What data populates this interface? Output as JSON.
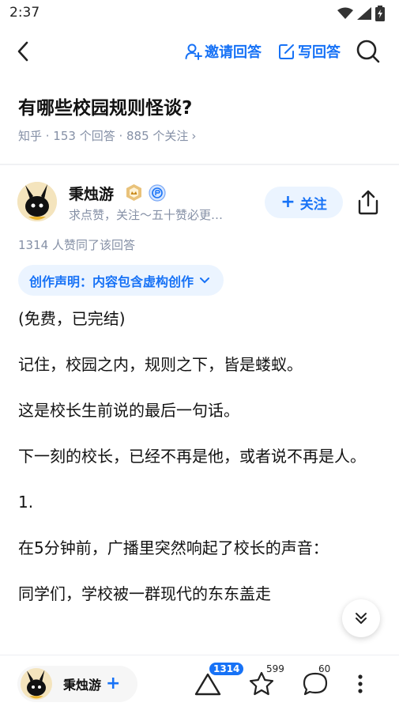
{
  "status": {
    "time": "2:37"
  },
  "nav": {
    "invite_label": "邀请回答",
    "write_label": "写回答"
  },
  "question": {
    "title": "有哪些校园规则怪谈?",
    "meta": "知乎 · 153 个回答 · 885 个关注",
    "meta_arrow": "›"
  },
  "author": {
    "name": "秉烛游",
    "bio": "求点赞，关注～五十赞必更…",
    "follow_label": "关注",
    "follow_plus": "+"
  },
  "answer": {
    "vote_info": "1314 人赞同了该回答",
    "declaration": "创作声明：内容包含虚构创作",
    "paragraphs": [
      "(免费，已完结)",
      "记住，校园之内，规则之下，皆是蝼蚁。",
      "这是校长生前说的最后一句话。",
      "下一刻的校长，已经不再是他，或者说不再是人。",
      "1.",
      "在5分钟前，广播里突然响起了校长的声音：",
      "同学们，学校被一群现代的东东盖走"
    ]
  },
  "bottom": {
    "author_name": "秉烛游",
    "author_plus": "+",
    "upvote_count": "1314",
    "star_count": "599",
    "comment_count": "60"
  },
  "colors": {
    "accent": "#1772f6",
    "accent_bg": "#ebf4ff",
    "meta_gray": "#8590a6"
  }
}
